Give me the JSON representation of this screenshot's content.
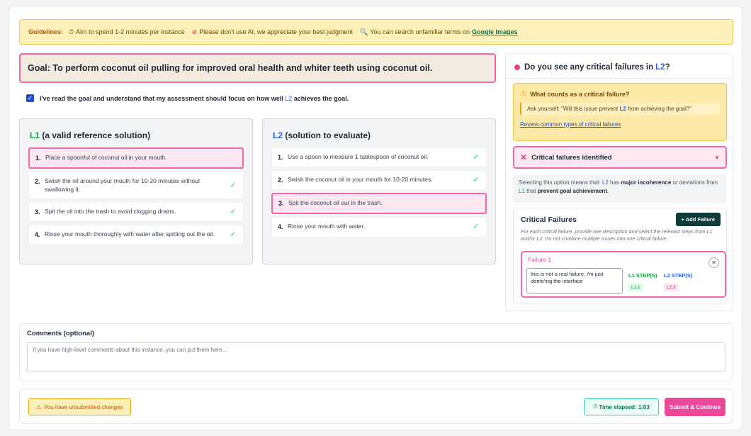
{
  "guidelines": {
    "label": "Guidelines:",
    "items": [
      {
        "icon": "⏱",
        "icon_name": "stopwatch-icon",
        "text": "Aim to spend 1-2 minutes per instance"
      },
      {
        "icon": "⊘",
        "icon_name": "prohibited-icon",
        "text": "Please don't use AI, we appreciate your best judgment"
      },
      {
        "icon": "🔍",
        "icon_name": "magnifier-icon",
        "text": "You can search unfamiliar terms on"
      }
    ],
    "link_text": "Google Images"
  },
  "goal": {
    "text": "Goal: To perform coconut oil pulling for improved oral health and whiter teeth using coconut oil."
  },
  "acknowledgment": {
    "checked": true,
    "pre": "I've read the goal and understand that my assessment should focus on how well",
    "tag": "L2",
    "post": "achieves the goal."
  },
  "l1": {
    "tag": "L1",
    "title": "(a valid reference solution)",
    "steps": [
      {
        "num": "1.",
        "text": "Place a spoonful of coconut oil in your mouth.",
        "highlighted": true,
        "check": ""
      },
      {
        "num": "2.",
        "text": "Swish the oil around your mouth for 10-20 minutes without swallowing it.",
        "highlighted": false,
        "check": "✓"
      },
      {
        "num": "3.",
        "text": "Spit the oil into the trash to avoid clogging drains.",
        "highlighted": false,
        "check": "✓"
      },
      {
        "num": "4.",
        "text": "Rinse your mouth thoroughly with water after spitting out the oil.",
        "highlighted": false,
        "check": "✓"
      }
    ]
  },
  "l2": {
    "tag": "L2",
    "title": "(solution to evaluate)",
    "steps": [
      {
        "num": "1.",
        "text": "Use a spoon to measure 1 tablespoon of coconut oil.",
        "highlighted": false,
        "check": "✓"
      },
      {
        "num": "2.",
        "text": "Swish the coconut oil in your mouth for 10-20 minutes.",
        "highlighted": false,
        "check": "✓"
      },
      {
        "num": "3.",
        "text": "Spit the coconut oil out in the trash.",
        "highlighted": true,
        "check": ""
      },
      {
        "num": "4.",
        "text": "Rinse your mouth with water.",
        "highlighted": false,
        "check": "✓"
      }
    ]
  },
  "critical": {
    "question_pre": "Do you see any critical failures in",
    "question_tag": "L2",
    "question_post": "?",
    "warning_title": "What counts as a critical failure?",
    "ask_pre": "Ask yourself: \"Will this issue prevent",
    "ask_tag": "L2",
    "ask_post": "from achieving the goal?\"",
    "review_link": "Review common types of critical failures",
    "selected_option": "Critical failures identified",
    "note_1": "Selecting this option means that:",
    "note_l2": "L2",
    "note_2": "has",
    "note_bold1": "major incoherence",
    "note_3": "or deviations from",
    "note_l1": "L1",
    "note_4": "that",
    "note_bold2": "prevent goal achievement",
    "note_5": ".",
    "cf_title": "Critical Failures",
    "add_label": "+ Add Failure",
    "cf_desc": "For each critical failure, provide one description and select the relevant steps from L1 and/or L2. Do not combine multiple issues into one critical failure.",
    "failure": {
      "title": "Failure 1",
      "description": "this is not a real failure, i'm just demo'ing the interface",
      "l1_label": "L1 STEP(S)",
      "l1_chip": "L1.1",
      "l2_label": "L2 STEP(S)",
      "l2_chip": "L2.3"
    }
  },
  "comments": {
    "title": "Comments (optional)",
    "placeholder": "If you have high-level comments about this instance, you can put them here...",
    "value": ""
  },
  "footer": {
    "unsubmitted": "You have unsubmitted changes",
    "timer": "Time elapsed: 1:03",
    "submit": "Submit & Continue"
  },
  "colors": {
    "accent_pink": "#ec4899",
    "l1_green": "#16a34a",
    "l2_blue": "#2563eb",
    "warning_yellow": "#fdf0b8",
    "dark_button": "#0f3b3a"
  }
}
